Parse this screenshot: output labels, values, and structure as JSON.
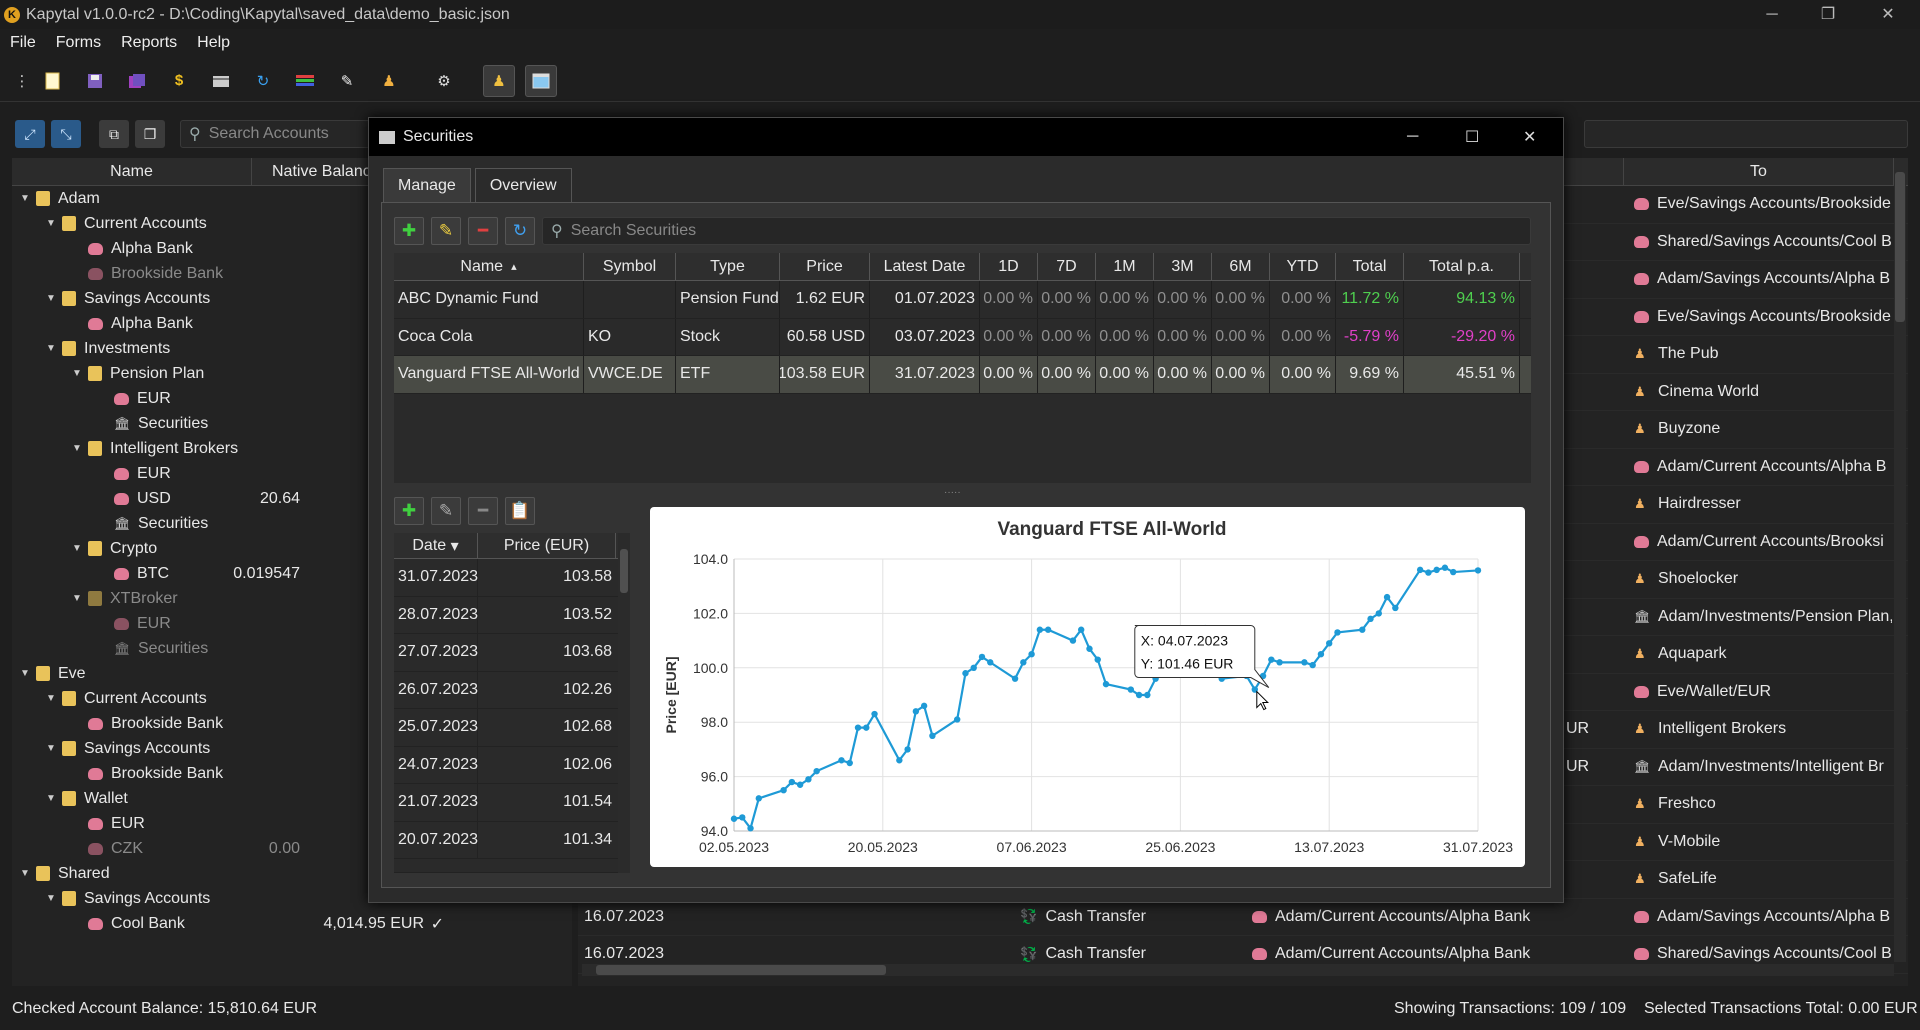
{
  "app": {
    "title": "Kapytal v1.0.0-rc2 - D:\\Coding\\Kapytal\\saved_data\\demo_basic.json",
    "icon_letter": "K"
  },
  "menu": [
    "File",
    "Forms",
    "Reports",
    "Help"
  ],
  "toolbar_icons": [
    "new-file-icon",
    "save-icon",
    "save-as-icon",
    "dollar-icon",
    "card-icon",
    "refresh-icon",
    "stack-icon",
    "pen-icon",
    "person-icon",
    "gear-icon",
    "person-panel-icon",
    "window-icon"
  ],
  "accounts": {
    "search_placeholder": "Search Accounts",
    "col_name": "Name",
    "col_balance": "Native Balanc"
  },
  "tree": [
    {
      "label": "Adam",
      "level": 0,
      "icon": "folder",
      "arrow": "▼"
    },
    {
      "label": "Current Accounts",
      "level": 1,
      "icon": "folder",
      "arrow": "▼"
    },
    {
      "label": "Alpha Bank",
      "level": 2,
      "icon": "piggy"
    },
    {
      "label": "Brookside Bank",
      "level": 2,
      "icon": "piggy",
      "dim": true
    },
    {
      "label": "Savings Accounts",
      "level": 1,
      "icon": "folder",
      "arrow": "▼"
    },
    {
      "label": "Alpha Bank",
      "level": 2,
      "icon": "piggy"
    },
    {
      "label": "Investments",
      "level": 1,
      "icon": "folder",
      "arrow": "▼"
    },
    {
      "label": "Pension Plan",
      "level": 2,
      "icon": "folder",
      "arrow": "▼"
    },
    {
      "label": "EUR",
      "level": 3,
      "icon": "piggy"
    },
    {
      "label": "Securities",
      "level": 3,
      "icon": "bank"
    },
    {
      "label": "Intelligent Brokers",
      "level": 2,
      "icon": "folder",
      "arrow": "▼"
    },
    {
      "label": "EUR",
      "level": 3,
      "icon": "piggy"
    },
    {
      "label": "USD",
      "level": 3,
      "icon": "piggy",
      "balance": "20.64"
    },
    {
      "label": "Securities",
      "level": 3,
      "icon": "bank"
    },
    {
      "label": "Crypto",
      "level": 2,
      "icon": "folder",
      "arrow": "▼"
    },
    {
      "label": "BTC",
      "level": 3,
      "icon": "piggy",
      "balance": "0.019547"
    },
    {
      "label": "XTBroker",
      "level": 2,
      "icon": "folder",
      "arrow": "▼",
      "dim": true
    },
    {
      "label": "EUR",
      "level": 3,
      "icon": "piggy",
      "dim": true
    },
    {
      "label": "Securities",
      "level": 3,
      "icon": "bank",
      "dim": true
    },
    {
      "label": "Eve",
      "level": 0,
      "icon": "folder",
      "arrow": "▼"
    },
    {
      "label": "Current Accounts",
      "level": 1,
      "icon": "folder",
      "arrow": "▼"
    },
    {
      "label": "Brookside Bank",
      "level": 2,
      "icon": "piggy"
    },
    {
      "label": "Savings Accounts",
      "level": 1,
      "icon": "folder",
      "arrow": "▼"
    },
    {
      "label": "Brookside Bank",
      "level": 2,
      "icon": "piggy"
    },
    {
      "label": "Wallet",
      "level": 1,
      "icon": "folder",
      "arrow": "▼"
    },
    {
      "label": "EUR",
      "level": 2,
      "icon": "piggy"
    },
    {
      "label": "CZK",
      "level": 2,
      "icon": "piggy",
      "dim": true,
      "balance": "0.00"
    },
    {
      "label": "Shared",
      "level": 0,
      "icon": "folder",
      "arrow": "▼"
    },
    {
      "label": "Savings Accounts",
      "level": 1,
      "icon": "folder",
      "arrow": "▼"
    },
    {
      "label": "Cool Bank",
      "level": 2,
      "icon": "piggy",
      "balance": "4,014.95 EUR",
      "check": "✓"
    }
  ],
  "transactions": {
    "col_to": "To",
    "rows": [
      {
        "to": "Eve/Savings Accounts/Brookside",
        "icon": "piggy"
      },
      {
        "to": "Shared/Savings Accounts/Cool B",
        "icon": "piggy"
      },
      {
        "to": "Adam/Savings Accounts/Alpha B",
        "icon": "piggy"
      },
      {
        "to": "Eve/Savings Accounts/Brookside",
        "icon": "piggy"
      },
      {
        "to": "The Pub",
        "icon": "person"
      },
      {
        "to": "Cinema World",
        "icon": "person"
      },
      {
        "to": "Buyzone",
        "icon": "person"
      },
      {
        "to": "Adam/Current Accounts/Alpha B",
        "icon": "piggy"
      },
      {
        "to": "Hairdresser",
        "icon": "person"
      },
      {
        "to": "Adam/Current Accounts/Brooksi",
        "icon": "piggy"
      },
      {
        "to": "Shoelocker",
        "icon": "person"
      },
      {
        "to": "Adam/Investments/Pension Plan,",
        "icon": "bank"
      },
      {
        "to": "Aquapark",
        "icon": "person"
      },
      {
        "to": "Eve/Wallet/EUR",
        "icon": "piggy"
      },
      {
        "to": "Intelligent Brokers",
        "icon": "person",
        "partial": "UR"
      },
      {
        "to": "Adam/Investments/Intelligent Br",
        "icon": "bank",
        "partial": "UR"
      },
      {
        "to": "Freshco",
        "icon": "person"
      },
      {
        "to": "V-Mobile",
        "icon": "person"
      },
      {
        "to": "SafeLife",
        "icon": "person"
      },
      {
        "to": "Adam/Savings Accounts/Alpha B",
        "icon": "piggy",
        "date": "16.07.2023",
        "type": "Cash Transfer",
        "from": "Adam/Current Accounts/Alpha Bank"
      },
      {
        "to": "Shared/Savings Accounts/Cool B",
        "icon": "piggy",
        "date": "16.07.2023",
        "type": "Cash Transfer",
        "from": "Adam/Current Accounts/Alpha Bank"
      }
    ]
  },
  "status": {
    "left": "Checked Account Balance: 15,810.64 EUR",
    "showing": "Showing Transactions: 109 / 109",
    "selected": "Selected Transactions Total: 0.00 EUR"
  },
  "securities": {
    "title": "Securities",
    "tabs": [
      "Manage",
      "Overview"
    ],
    "search_placeholder": "Search Securities",
    "headers": [
      "Name",
      "Symbol",
      "Type",
      "Price",
      "Latest Date",
      "1D",
      "7D",
      "1M",
      "3M",
      "6M",
      "YTD",
      "Total",
      "Total p.a."
    ],
    "rows": [
      {
        "name": "ABC Dynamic Fund",
        "symbol": "",
        "type": "Pension Fund",
        "price": "1.62 EUR",
        "date": "01.07.2023",
        "d1": "0.00 %",
        "d7": "0.00 %",
        "m1": "0.00 %",
        "m3": "0.00 %",
        "m6": "0.00 %",
        "ytd": "0.00 %",
        "total": "11.72 %",
        "pa": "94.13 %",
        "total_sign": "pos"
      },
      {
        "name": "Coca Cola",
        "symbol": "KO",
        "type": "Stock",
        "price": "60.58 USD",
        "date": "03.07.2023",
        "d1": "0.00 %",
        "d7": "0.00 %",
        "m1": "0.00 %",
        "m3": "0.00 %",
        "m6": "0.00 %",
        "ytd": "0.00 %",
        "total": "-5.79 %",
        "pa": "-29.20 %",
        "total_sign": "neg"
      },
      {
        "name": "Vanguard FTSE All-World",
        "symbol": "VWCE.DE",
        "type": "ETF",
        "price": "103.58 EUR",
        "date": "31.07.2023",
        "d1": "0.00 %",
        "d7": "0.00 %",
        "m1": "0.00 %",
        "m3": "0.00 %",
        "m6": "0.00 %",
        "ytd": "0.00 %",
        "total": "9.69 %",
        "pa": "45.51 %",
        "total_sign": "neutral",
        "selected": true
      }
    ],
    "price_headers": [
      "Date",
      "Price (EUR)"
    ],
    "prices": [
      {
        "date": "31.07.2023",
        "price": "103.58"
      },
      {
        "date": "28.07.2023",
        "price": "103.52"
      },
      {
        "date": "27.07.2023",
        "price": "103.68"
      },
      {
        "date": "26.07.2023",
        "price": "102.26"
      },
      {
        "date": "25.07.2023",
        "price": "102.68"
      },
      {
        "date": "24.07.2023",
        "price": "102.06"
      },
      {
        "date": "21.07.2023",
        "price": "101.54"
      },
      {
        "date": "20.07.2023",
        "price": "101.34"
      }
    ]
  },
  "chart_data": {
    "type": "line",
    "title": "Vanguard FTSE All-World",
    "xlabel": "",
    "ylabel": "Price [EUR]",
    "ylim": [
      94.0,
      104.0
    ],
    "yticks": [
      "104.0",
      "102.0",
      "100.0",
      "98.0",
      "96.0",
      "94.0"
    ],
    "xticks": [
      "02.05.2023",
      "20.05.2023",
      "07.06.2023",
      "25.06.2023",
      "13.07.2023",
      "31.07.2023"
    ],
    "grid": true,
    "color": "#1e9ad6",
    "tooltip": {
      "x": "X: 04.07.2023",
      "y": "Y: 101.46 EUR"
    },
    "x": [
      "02.05.2023",
      "03.05.2023",
      "04.05.2023",
      "05.05.2023",
      "08.05.2023",
      "09.05.2023",
      "10.05.2023",
      "11.05.2023",
      "12.05.2023",
      "15.05.2023",
      "16.05.2023",
      "17.05.2023",
      "18.05.2023",
      "19.05.2023",
      "22.05.2023",
      "23.05.2023",
      "24.05.2023",
      "25.05.2023",
      "26.05.2023",
      "29.05.2023",
      "30.05.2023",
      "31.05.2023",
      "01.06.2023",
      "02.06.2023",
      "05.06.2023",
      "06.06.2023",
      "07.06.2023",
      "08.06.2023",
      "09.06.2023",
      "12.06.2023",
      "13.06.2023",
      "14.06.2023",
      "15.06.2023",
      "16.06.2023",
      "19.06.2023",
      "20.06.2023",
      "21.06.2023",
      "22.06.2023",
      "23.06.2023",
      "26.06.2023",
      "27.06.2023",
      "28.06.2023",
      "29.06.2023",
      "30.06.2023",
      "03.07.2023",
      "04.07.2023",
      "05.07.2023",
      "06.07.2023",
      "07.07.2023",
      "10.07.2023",
      "11.07.2023",
      "12.07.2023",
      "13.07.2023",
      "14.07.2023",
      "17.07.2023",
      "18.07.2023",
      "19.07.2023",
      "20.07.2023",
      "21.07.2023",
      "24.07.2023",
      "25.07.2023",
      "26.07.2023",
      "27.07.2023",
      "28.07.2023",
      "31.07.2023"
    ],
    "values": [
      94.45,
      94.5,
      94.1,
      95.2,
      95.5,
      95.8,
      95.7,
      95.9,
      96.2,
      96.6,
      96.5,
      97.8,
      97.8,
      98.3,
      96.6,
      97.0,
      98.4,
      98.6,
      97.5,
      98.1,
      99.8,
      100.0,
      100.4,
      100.2,
      99.6,
      100.2,
      100.5,
      101.4,
      101.4,
      101.0,
      101.4,
      100.7,
      100.3,
      99.4,
      99.2,
      99.0,
      99.0,
      99.6,
      100.0,
      101.0,
      101.4,
      101.46,
      101.2,
      99.6,
      99.7,
      99.2,
      99.7,
      100.3,
      100.2,
      100.2,
      100.1,
      100.5,
      100.9,
      101.3,
      101.4,
      101.8,
      102.0,
      102.6,
      102.2,
      103.6,
      103.5,
      103.6,
      103.68,
      103.52,
      103.58
    ]
  }
}
